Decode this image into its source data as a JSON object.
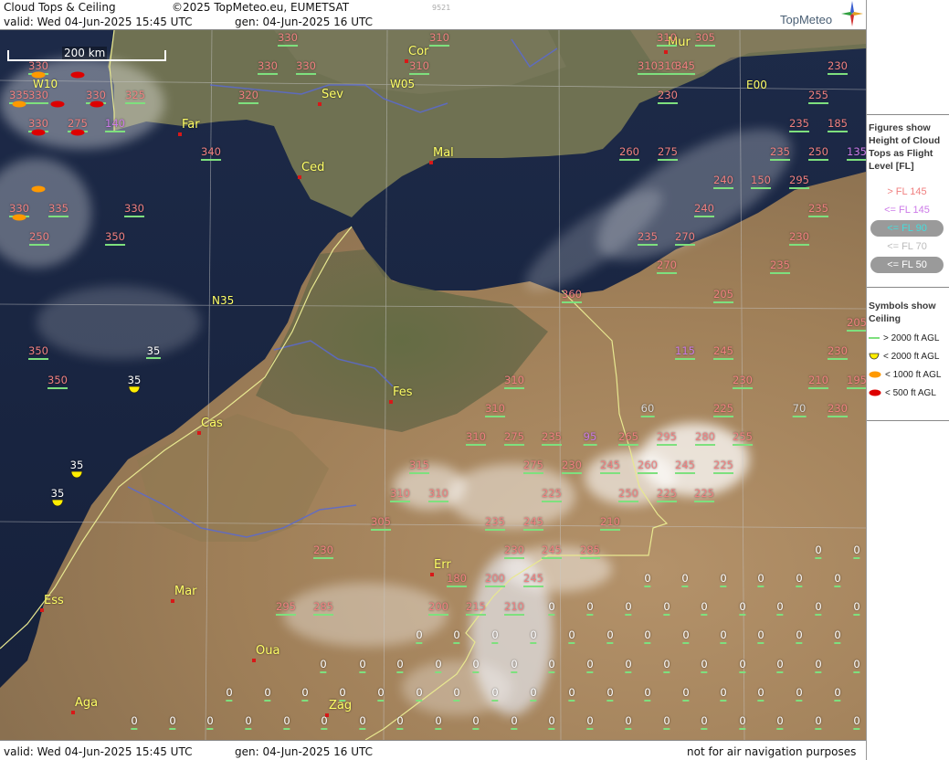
{
  "header": {
    "title": "Cloud Tops & Ceiling",
    "copyright": "©2025 TopMeteo.eu, EUMETSAT",
    "valid": "valid:  Wed  04-Jun-2025  15:45 UTC",
    "generated": "gen: 04-Jun-2025 16 UTC",
    "image_id": "9521",
    "brand": "TopMeteo"
  },
  "footer": {
    "valid": "valid:  Wed  04-Jun-2025  15:45 UTC",
    "generated": "gen: 04-Jun-2025 16 UTC",
    "disclaimer": "not for air navigation purposes"
  },
  "scale_label": "200 km",
  "grid_labels": {
    "lon_w10": "W10",
    "lon_w05": "W05",
    "lon_e00": "E00",
    "lat_n35": "N35"
  },
  "colors": {
    "above_fl145": "#f08080",
    "fl145": "#cc7ae8",
    "fl90": "#44dddd",
    "fl70": "#bbbbbb",
    "fl50": "#ffffff",
    "ceiling_gt2000": "#7ee07e",
    "ceiling_lt2000": "#ffee00",
    "ceiling_lt1000": "#ff9900",
    "ceiling_lt500": "#dd0000",
    "city_label": "#ffff66",
    "border": "#e8e890",
    "river": "#5a6ad0"
  },
  "legend": {
    "heights_title": [
      "Figures show",
      "Height of Cloud",
      "Tops as Flight",
      "Level  [FL]"
    ],
    "levels": [
      {
        "label": "> FL 145",
        "color": "#f08080",
        "pill": false
      },
      {
        "label": "<= FL 145",
        "color": "#cc7ae8",
        "pill": false
      },
      {
        "label": "<= FL 90",
        "color": "#44dddd",
        "pill": true
      },
      {
        "label": "<= FL 70",
        "color": "#bbbbbb",
        "pill": false
      },
      {
        "label": "<= FL 50",
        "color": "#ffffff",
        "pill": true
      }
    ],
    "ceiling_title": [
      "Symbols show",
      "Ceiling"
    ],
    "ceilings": [
      {
        "label": "> 2000 ft AGL",
        "symbol": "line",
        "color": "#7ee07e"
      },
      {
        "label": "< 2000 ft AGL",
        "symbol": "half-disc",
        "color": "#ffee00"
      },
      {
        "label": "< 1000 ft AGL",
        "symbol": "oval",
        "color": "#ff9900"
      },
      {
        "label": "< 500 ft AGL",
        "symbol": "oval",
        "color": "#dd0000"
      }
    ]
  },
  "cities": [
    {
      "name": "Cor"
    },
    {
      "name": "Mur"
    },
    {
      "name": "Sev"
    },
    {
      "name": "Far"
    },
    {
      "name": "Ced"
    },
    {
      "name": "Mal"
    },
    {
      "name": "Fes"
    },
    {
      "name": "Cas"
    },
    {
      "name": "Err"
    },
    {
      "name": "Mar"
    },
    {
      "name": "Ess"
    },
    {
      "name": "Oua"
    },
    {
      "name": "Aga"
    },
    {
      "name": "Zag"
    }
  ],
  "cloud_tops": [
    {
      "v": "330",
      "c": "salmon"
    },
    {
      "v": "310",
      "c": "salmon"
    },
    {
      "v": "310",
      "c": "salmon"
    },
    {
      "v": "310",
      "c": "salmon"
    },
    {
      "v": "305",
      "c": "salmon"
    },
    {
      "v": "330",
      "c": "salmon"
    },
    {
      "v": "330",
      "c": "salmon"
    },
    {
      "v": "330",
      "c": "salmon"
    },
    {
      "v": "310",
      "c": "salmon"
    },
    {
      "v": "310",
      "c": "salmon"
    },
    {
      "v": "345",
      "c": "salmon"
    },
    {
      "v": "230",
      "c": "salmon"
    },
    {
      "v": "330",
      "c": "salmon"
    },
    {
      "v": "335",
      "c": "salmon"
    },
    {
      "v": "330",
      "c": "salmon"
    },
    {
      "v": "325",
      "c": "salmon"
    },
    {
      "v": "320",
      "c": "salmon"
    },
    {
      "v": "230",
      "c": "salmon"
    },
    {
      "v": "255",
      "c": "salmon"
    },
    {
      "v": "330",
      "c": "salmon"
    },
    {
      "v": "275",
      "c": "salmon"
    },
    {
      "v": "140",
      "c": "violet"
    },
    {
      "v": "235",
      "c": "salmon"
    },
    {
      "v": "185",
      "c": "salmon"
    },
    {
      "v": "340",
      "c": "salmon"
    },
    {
      "v": "260",
      "c": "salmon"
    },
    {
      "v": "275",
      "c": "salmon"
    },
    {
      "v": "235",
      "c": "salmon"
    },
    {
      "v": "250",
      "c": "salmon"
    },
    {
      "v": "135",
      "c": "violet"
    },
    {
      "v": "240",
      "c": "salmon"
    },
    {
      "v": "150",
      "c": "salmon"
    },
    {
      "v": "295",
      "c": "salmon"
    },
    {
      "v": "330",
      "c": "salmon"
    },
    {
      "v": "335",
      "c": "salmon"
    },
    {
      "v": "330",
      "c": "salmon"
    },
    {
      "v": "240",
      "c": "salmon"
    },
    {
      "v": "235",
      "c": "salmon"
    },
    {
      "v": "250",
      "c": "salmon"
    },
    {
      "v": "350",
      "c": "salmon"
    },
    {
      "v": "235",
      "c": "salmon"
    },
    {
      "v": "270",
      "c": "salmon"
    },
    {
      "v": "230",
      "c": "salmon"
    },
    {
      "v": "270",
      "c": "salmon"
    },
    {
      "v": "235",
      "c": "salmon"
    },
    {
      "v": "360",
      "c": "salmon"
    },
    {
      "v": "205",
      "c": "salmon"
    },
    {
      "v": "205",
      "c": "salmon"
    },
    {
      "v": "350",
      "c": "salmon"
    },
    {
      "v": "115",
      "c": "violet"
    },
    {
      "v": "245",
      "c": "salmon"
    },
    {
      "v": "230",
      "c": "salmon"
    },
    {
      "v": "350",
      "c": "salmon"
    },
    {
      "v": "310",
      "c": "salmon"
    },
    {
      "v": "230",
      "c": "salmon"
    },
    {
      "v": "210",
      "c": "salmon"
    },
    {
      "v": "195",
      "c": "salmon"
    },
    {
      "v": "310",
      "c": "salmon"
    },
    {
      "v": "60",
      "c": "grey"
    },
    {
      "v": "225",
      "c": "salmon"
    },
    {
      "v": "70",
      "c": "grey"
    },
    {
      "v": "230",
      "c": "salmon"
    },
    {
      "v": "310",
      "c": "salmon"
    },
    {
      "v": "275",
      "c": "salmon"
    },
    {
      "v": "235",
      "c": "salmon"
    },
    {
      "v": "95",
      "c": "violet"
    },
    {
      "v": "265",
      "c": "salmon"
    },
    {
      "v": "295",
      "c": "salmon"
    },
    {
      "v": "280",
      "c": "salmon"
    },
    {
      "v": "255",
      "c": "salmon"
    },
    {
      "v": "315",
      "c": "salmon"
    },
    {
      "v": "275",
      "c": "salmon"
    },
    {
      "v": "230",
      "c": "salmon"
    },
    {
      "v": "245",
      "c": "salmon"
    },
    {
      "v": "260",
      "c": "salmon"
    },
    {
      "v": "245",
      "c": "salmon"
    },
    {
      "v": "225",
      "c": "salmon"
    },
    {
      "v": "310",
      "c": "salmon"
    },
    {
      "v": "310",
      "c": "salmon"
    },
    {
      "v": "225",
      "c": "salmon"
    },
    {
      "v": "250",
      "c": "salmon"
    },
    {
      "v": "225",
      "c": "salmon"
    },
    {
      "v": "225",
      "c": "salmon"
    },
    {
      "v": "305",
      "c": "salmon"
    },
    {
      "v": "235",
      "c": "salmon"
    },
    {
      "v": "245",
      "c": "salmon"
    },
    {
      "v": "210",
      "c": "salmon"
    },
    {
      "v": "230",
      "c": "salmon"
    },
    {
      "v": "230",
      "c": "salmon"
    },
    {
      "v": "245",
      "c": "salmon"
    },
    {
      "v": "285",
      "c": "salmon"
    },
    {
      "v": "180",
      "c": "salmon"
    },
    {
      "v": "200",
      "c": "salmon"
    },
    {
      "v": "245",
      "c": "salmon"
    },
    {
      "v": "295",
      "c": "salmon"
    },
    {
      "v": "285",
      "c": "salmon"
    },
    {
      "v": "200",
      "c": "salmon"
    },
    {
      "v": "215",
      "c": "salmon"
    },
    {
      "v": "210",
      "c": "salmon"
    }
  ],
  "ceiling_symbols": [
    {
      "v": "330",
      "type": "orange"
    },
    {
      "v": "330",
      "type": "red"
    },
    {
      "v": "335",
      "type": "orange"
    },
    {
      "v": "330",
      "type": "red"
    },
    {
      "v": "330",
      "type": "red"
    },
    {
      "v": "330",
      "type": "red"
    },
    {
      "v": "275",
      "type": "red"
    },
    {
      "v": "30",
      "type": "orange"
    },
    {
      "v": "330",
      "type": "orange"
    },
    {
      "v": "35",
      "type": "line"
    },
    {
      "v": "35",
      "type": "yellow"
    },
    {
      "v": "35",
      "type": "yellow"
    },
    {
      "v": "35",
      "type": "yellow"
    }
  ],
  "zero_label": "0"
}
